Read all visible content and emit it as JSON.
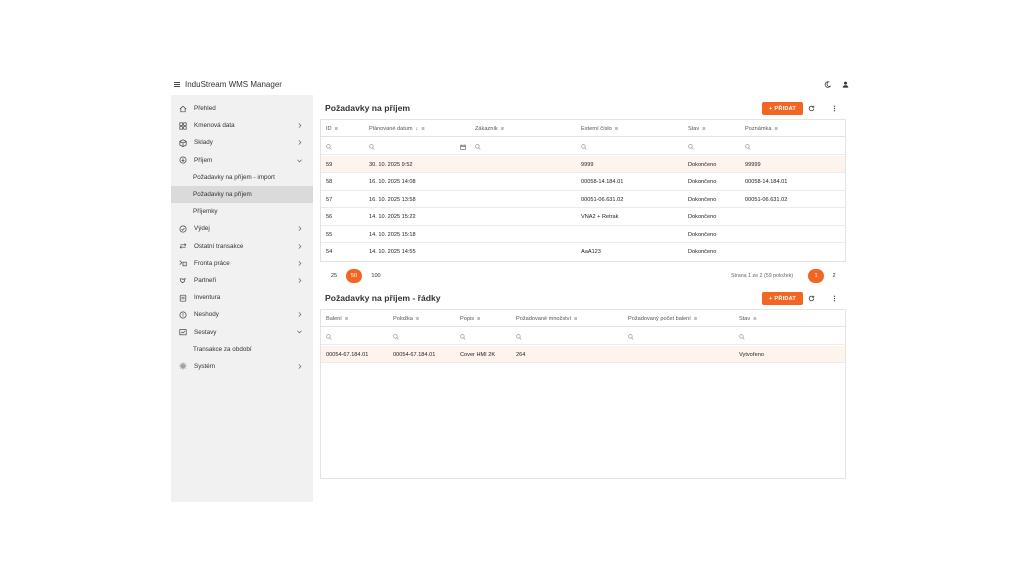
{
  "app": {
    "title": "InduStream WMS Manager"
  },
  "sidebar": {
    "items": [
      {
        "label": "Přehled"
      },
      {
        "label": "Kmenová data"
      },
      {
        "label": "Sklady"
      },
      {
        "label": "Příjem"
      },
      {
        "label": "Požadavky na příjem - import"
      },
      {
        "label": "Požadavky na příjem"
      },
      {
        "label": "Příjemky"
      },
      {
        "label": "Výdej"
      },
      {
        "label": "Ostatní transakce"
      },
      {
        "label": "Fronta práce"
      },
      {
        "label": "Partneři"
      },
      {
        "label": "Inventura"
      },
      {
        "label": "Neshody"
      },
      {
        "label": "Sestavy"
      },
      {
        "label": "Transakce za období"
      },
      {
        "label": "Systém"
      }
    ]
  },
  "requests": {
    "title": "Požadavky na příjem",
    "add_label": "PŘIDAT",
    "columns": [
      "ID",
      "Plánované datum",
      "Zákazník",
      "Externí číslo",
      "Stav",
      "Poznámka"
    ],
    "rows": [
      [
        "59",
        "30. 10. 2025 9:52",
        "",
        "9999",
        "Dokončeno",
        "99999"
      ],
      [
        "58",
        "16. 10. 2025 14:08",
        "",
        "00058-14.184.01",
        "Dokončeno",
        "00058-14.184.01"
      ],
      [
        "57",
        "16. 10. 2025 13:58",
        "",
        "00051-06.631.02",
        "Dokončeno",
        "00051-06.631.02"
      ],
      [
        "56",
        "14. 10. 2025 15:22",
        "",
        "VNA2 + Retrak",
        "Dokončeno",
        ""
      ],
      [
        "55",
        "14. 10. 2025 15:18",
        "",
        "",
        "Dokončeno",
        ""
      ],
      [
        "54",
        "14. 10. 2025 14:55",
        "",
        "AaA123",
        "Dokončeno",
        ""
      ]
    ],
    "page_sizes": [
      "25",
      "50",
      "100"
    ],
    "page_info": "Strana 1 ze 2 (59 položek)",
    "pages": [
      "1",
      "2"
    ]
  },
  "lines": {
    "title": "Požadavky na příjem - řádky",
    "add_label": "PŘIDAT",
    "columns": [
      "Balení",
      "Položka",
      "Popis",
      "Požadované množství",
      "Požadovaný počet balení",
      "Stav"
    ],
    "rows": [
      [
        "00054-67.184.01",
        "00054-67.184.01",
        "Cover HMI 2K",
        "264",
        "",
        "Vytvořeno"
      ]
    ]
  },
  "colors": {
    "accent": "#f26522",
    "selected_row": "#fef4ee",
    "sidebar_bg": "#f1f1f1",
    "sidebar_active": "#dadada"
  }
}
